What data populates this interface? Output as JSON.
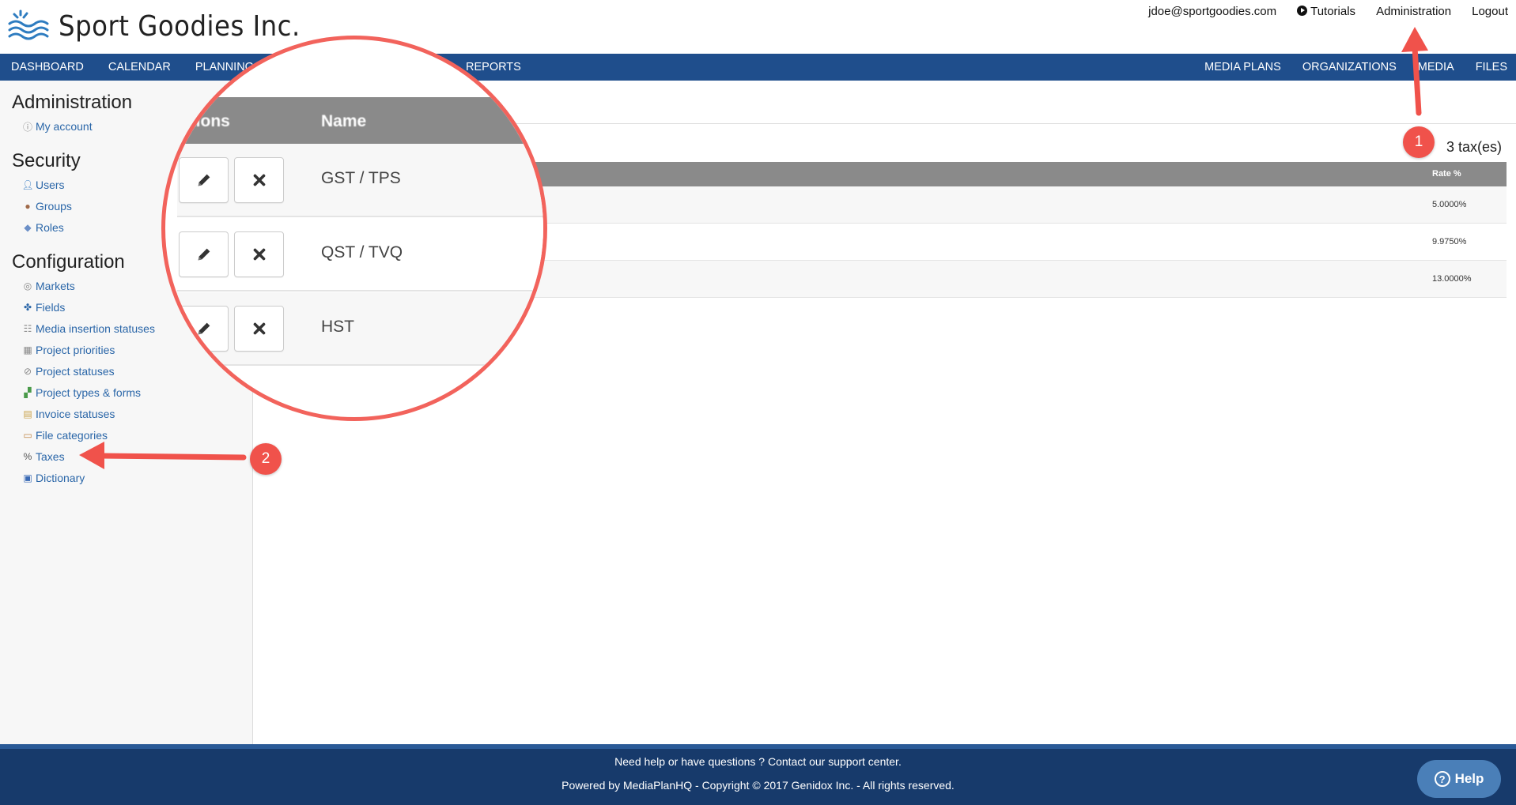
{
  "brand": {
    "name": "Sport Goodies Inc."
  },
  "topnav": {
    "email": "jdoe@sportgoodies.com",
    "tutorials": "Tutorials",
    "administration": "Administration",
    "logout": "Logout"
  },
  "mainnav": {
    "left": [
      "DASHBOARD",
      "CALENDAR",
      "PLANNING"
    ],
    "reports": "REPORTS",
    "right": [
      "MEDIA PLANS",
      "ORGANIZATIONS",
      "MEDIA",
      "FILES"
    ]
  },
  "sidebar": {
    "admin_heading": "Administration",
    "my_account": "My account",
    "security_heading": "Security",
    "users": "Users",
    "groups": "Groups",
    "roles": "Roles",
    "config_heading": "Configuration",
    "markets": "Markets",
    "fields": "Fields",
    "media_insertion_statuses": "Media insertion statuses",
    "project_priorities": "Project priorities",
    "project_statuses": "Project statuses",
    "project_types": "Project types & forms",
    "invoice_statuses": "Invoice statuses",
    "file_categories": "File categories",
    "taxes": "Taxes",
    "dictionary": "Dictionary"
  },
  "content": {
    "count": "3 tax(es)",
    "columns": {
      "actions": "ctions",
      "name": "Name",
      "rate": "Rate %"
    },
    "rows": [
      {
        "name": "GST / TPS",
        "rate": "5.0000%"
      },
      {
        "name": "QST / TVQ",
        "rate": "9.9750%"
      },
      {
        "name": "HST",
        "rate": "13.0000%"
      }
    ]
  },
  "footer": {
    "line1": "Need help or have questions ? Contact our support center.",
    "line2": "Powered by MediaPlanHQ - Copyright © 2017 Genidox Inc. - All rights reserved."
  },
  "help": {
    "label": "Help"
  },
  "annotations": {
    "badge1": "1",
    "badge2": "2",
    "color": "#f0524b"
  }
}
